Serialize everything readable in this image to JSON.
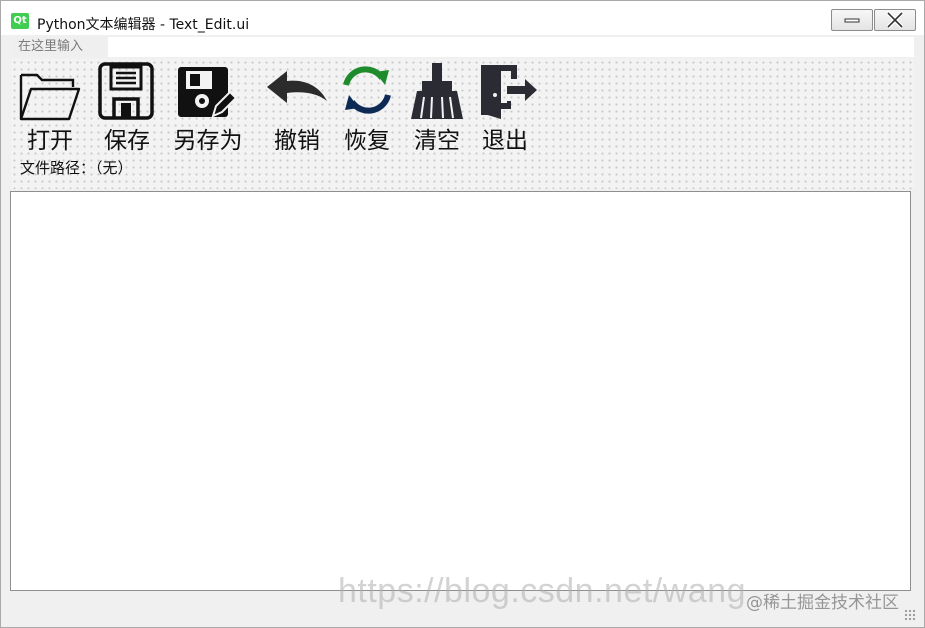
{
  "window": {
    "title": "Python文本编辑器 - Text_Edit.ui",
    "app_icon_text": "Qt",
    "minimize_icon": "minimize-icon",
    "close_icon": "close-icon"
  },
  "menubar": {
    "input_placeholder": "在这里输入"
  },
  "toolbar": {
    "items": [
      {
        "label": "打开",
        "icon": "folder-open-icon"
      },
      {
        "label": "保存",
        "icon": "floppy-disk-icon"
      },
      {
        "label": "另存为",
        "icon": "floppy-disk-edit-icon"
      },
      {
        "label": "撤销",
        "icon": "undo-arrow-icon"
      },
      {
        "label": "恢复",
        "icon": "refresh-icon"
      },
      {
        "label": "清空",
        "icon": "broom-icon"
      },
      {
        "label": "退出",
        "icon": "exit-door-icon"
      }
    ]
  },
  "file_path": {
    "text": "文件路径：（无）"
  },
  "editor": {
    "content": ""
  },
  "watermarks": {
    "url": "https://blog.csdn.net/wang",
    "site": "@稀土掘金技术社区"
  },
  "colors": {
    "refresh_green": "#1e8b2c",
    "refresh_navy": "#0d2a55",
    "icon_dark": "#2b2b33"
  }
}
